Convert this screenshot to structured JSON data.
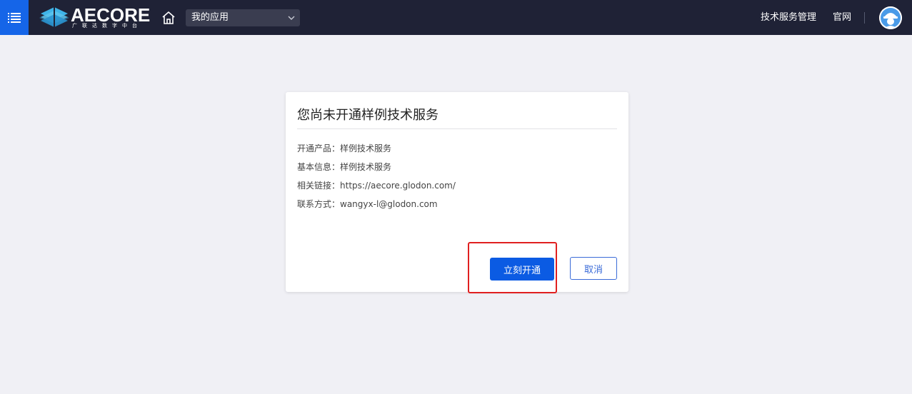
{
  "header": {
    "logo_text": "AECORE",
    "logo_subtitle": "广联达数字中台",
    "app_select": {
      "selected": "我的应用"
    },
    "nav": {
      "tech_service": "技术服务管理",
      "official_site": "官网"
    },
    "colors": {
      "bar_bg": "#1f2236",
      "menu_bg": "#1565e8",
      "logo_accent": "#3fb4e8"
    }
  },
  "dialog": {
    "title": "您尚未开通样例技术服务",
    "rows": [
      {
        "label": "开通产品：",
        "value": "样例技术服务"
      },
      {
        "label": "基本信息：",
        "value": "样例技术服务"
      },
      {
        "label": "相关链接：",
        "value": "https://aecore.glodon.com/"
      },
      {
        "label": "联系方式：",
        "value": "wangyx-l@glodon.com"
      }
    ],
    "primary_button": "立刻开通",
    "cancel_button": "取消",
    "colors": {
      "primary": "#0b5be3",
      "highlight": "#e02020"
    }
  },
  "icons": [
    "menu-icon",
    "home-icon",
    "chevron-down-icon",
    "avatar-icon"
  ]
}
